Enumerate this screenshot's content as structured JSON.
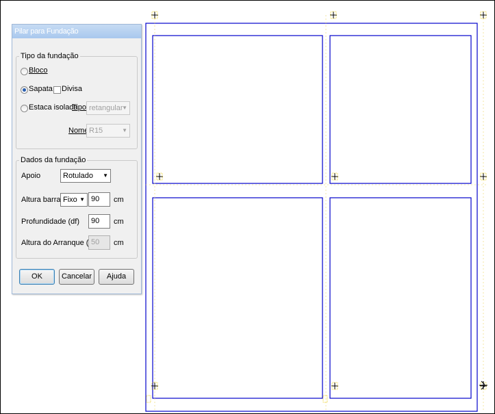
{
  "dialog": {
    "title": "Pilar para Fundação",
    "group_foundation_type": {
      "legend": "Tipo da fundação",
      "radio_bloco": "Bloco",
      "radio_sapata": "Sapata",
      "check_divisa": "Divisa",
      "radio_estaca": "Estaca isolada",
      "tipo_label": "Tipo",
      "tipo_value": "retangular",
      "nome_label": "Nome",
      "nome_value": "R15",
      "selected": "Sapata"
    },
    "group_foundation_data": {
      "legend": "Dados da fundação",
      "apoio_label": "Apoio",
      "apoio_value": "Rotulado",
      "altura_barra_label": "Altura barra",
      "altura_barra_mode": "Fixo",
      "altura_barra_value": "90",
      "altura_barra_unit": "cm",
      "profundidade_label": "Profundidade (df)",
      "profundidade_value": "90",
      "profundidade_unit": "cm",
      "altura_arranque_label": "Altura do Arranque (ha)",
      "altura_arranque_value": "50",
      "altura_arranque_unit": "cm"
    },
    "buttons": {
      "ok": "OK",
      "cancel": "Cancelar",
      "help": "Ajuda"
    }
  },
  "colors": {
    "drawing_lines": "#0000cc",
    "markers": "#e8c800"
  }
}
